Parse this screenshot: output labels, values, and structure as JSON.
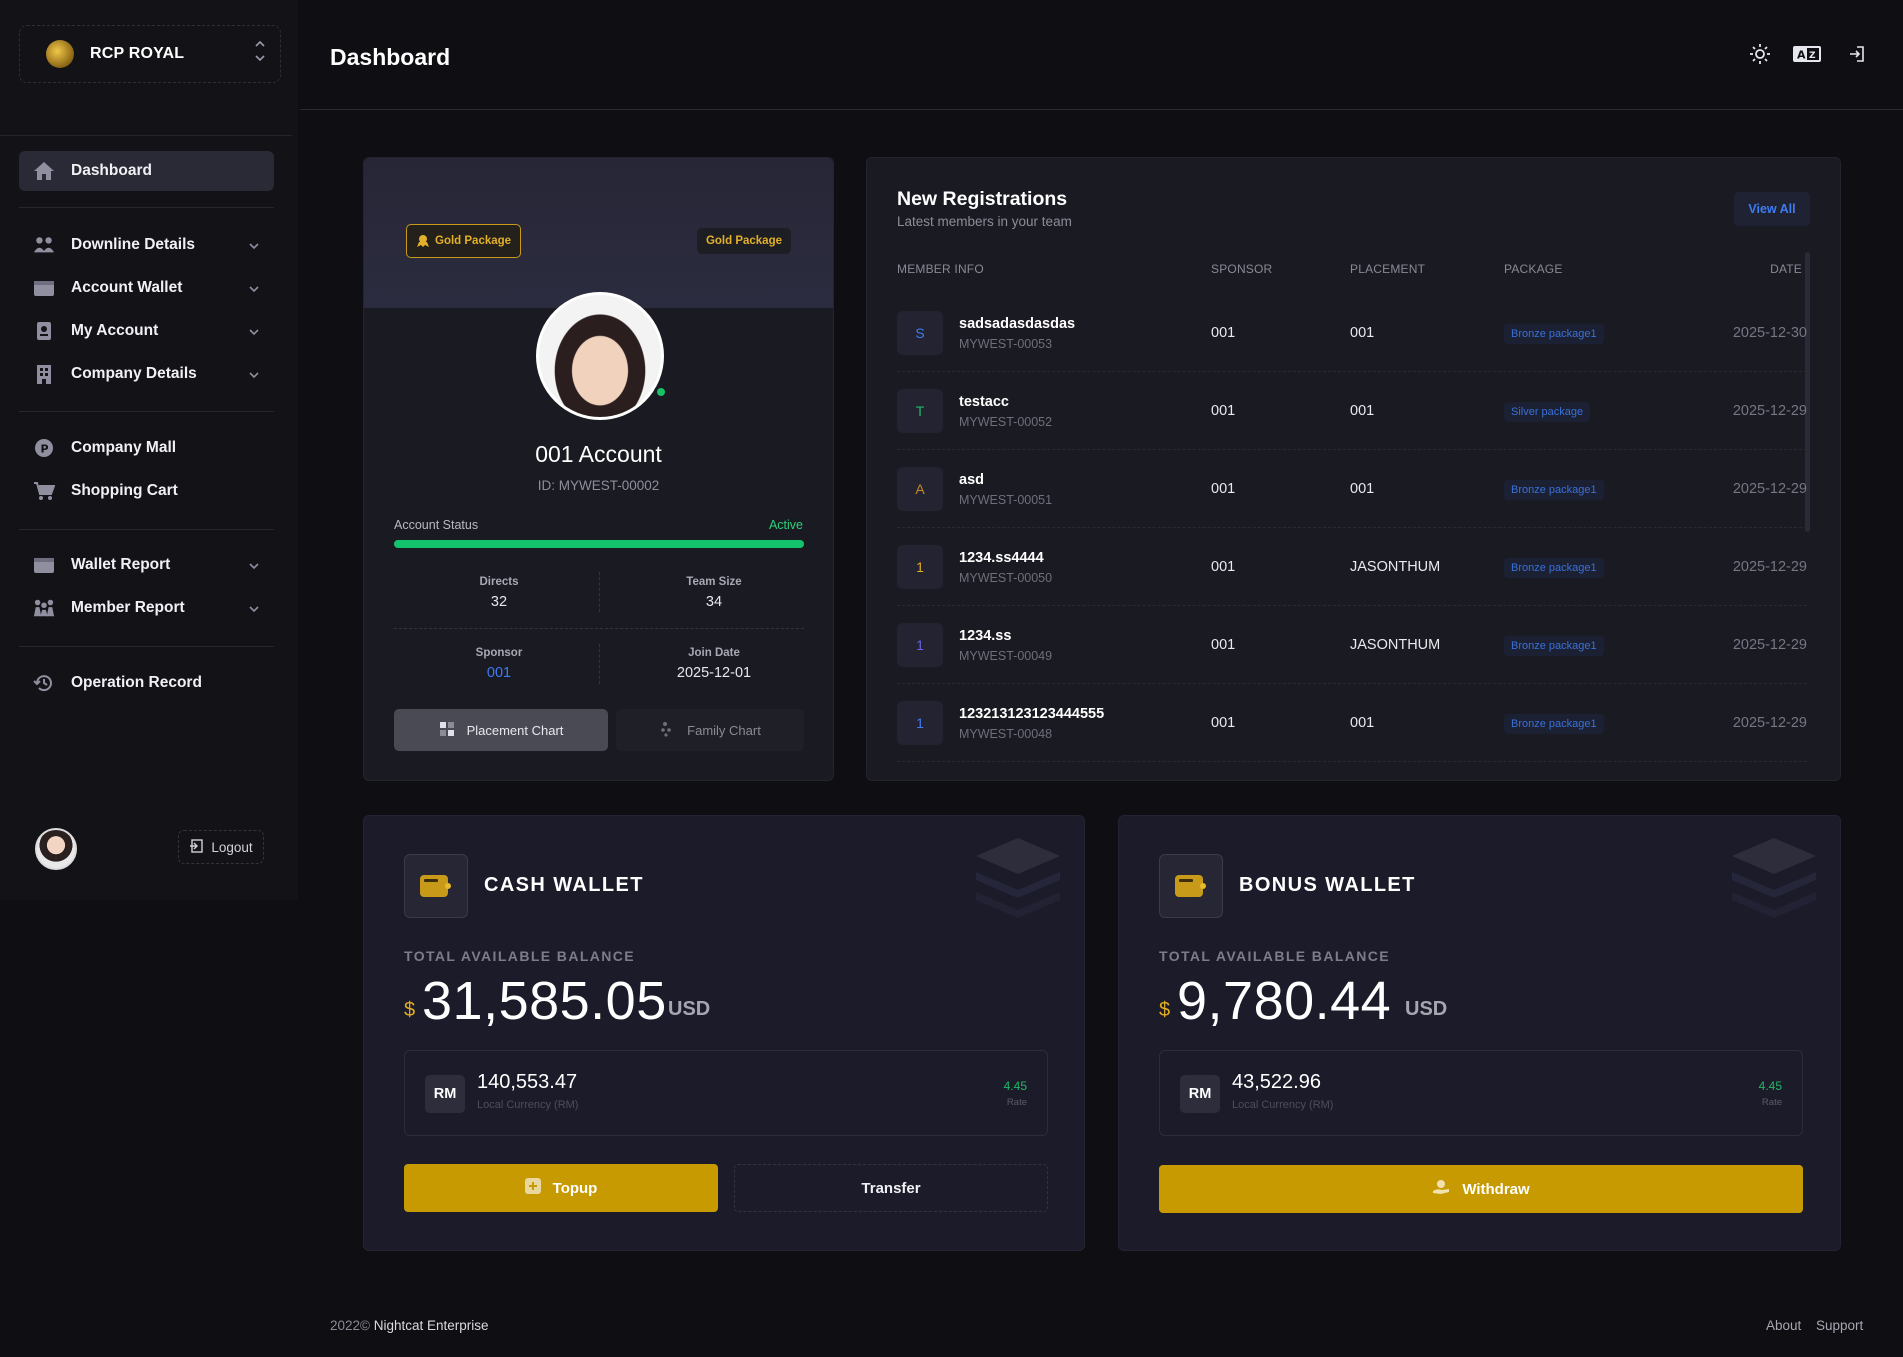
{
  "brand": {
    "name": "RCP ROYAL"
  },
  "sidebar": {
    "items": [
      {
        "label": "Dashboard",
        "icon": "home-icon"
      },
      {
        "label": "Downline Details",
        "icon": "users-icon"
      },
      {
        "label": "Account Wallet",
        "icon": "wallet-icon"
      },
      {
        "label": "My Account",
        "icon": "id-card-icon"
      },
      {
        "label": "Company Details",
        "icon": "building-icon"
      },
      {
        "label": "Company Mall",
        "icon": "mall-icon"
      },
      {
        "label": "Shopping Cart",
        "icon": "cart-icon"
      },
      {
        "label": "Wallet Report",
        "icon": "wallet-icon"
      },
      {
        "label": "Member Report",
        "icon": "group-icon"
      },
      {
        "label": "Operation Record",
        "icon": "history-icon"
      }
    ],
    "logout_label": "Logout"
  },
  "header": {
    "title": "Dashboard"
  },
  "profile": {
    "package_badge": "Gold Package",
    "package_tag": "Gold Package",
    "name": "001 Account",
    "id": "ID: MYWEST-00002",
    "status_label": "Account Status",
    "status_value": "Active",
    "status_progress": 1.0,
    "stats": {
      "directs_label": "Directs",
      "directs": "32",
      "team_label": "Team Size",
      "team": "34",
      "sponsor_label": "Sponsor",
      "sponsor": "001",
      "join_label": "Join Date",
      "join": "2025-12-01"
    },
    "placement_chart": "Placement Chart",
    "family_chart": "Family Chart"
  },
  "registrations": {
    "title": "New Registrations",
    "subtitle": "Latest members in your team",
    "view_all": "View All",
    "columns": [
      "MEMBER INFO",
      "SPONSOR",
      "PLACEMENT",
      "PACKAGE",
      "DATE"
    ],
    "rows": [
      {
        "initial": "S",
        "name": "sadsadasdasdas",
        "id": "MYWEST-00053",
        "sponsor": "001",
        "placement": "001",
        "package": "Bronze package1",
        "date": "2025-12-30",
        "color": "#3e7cf2"
      },
      {
        "initial": "T",
        "name": "testacc",
        "id": "MYWEST-00052",
        "sponsor": "001",
        "placement": "001",
        "package": "Silver package",
        "date": "2025-12-29",
        "color": "#1fb867"
      },
      {
        "initial": "A",
        "name": "asd",
        "id": "MYWEST-00051",
        "sponsor": "001",
        "placement": "001",
        "package": "Bronze package1",
        "date": "2025-12-29",
        "color": "#c9862a"
      },
      {
        "initial": "1",
        "name": "1234.ss4444",
        "id": "MYWEST-00050",
        "sponsor": "001",
        "placement": "JASONTHUM",
        "package": "Bronze package1",
        "date": "2025-12-29",
        "color": "#e3ad22"
      },
      {
        "initial": "1",
        "name": "1234.ss",
        "id": "MYWEST-00049",
        "sponsor": "001",
        "placement": "JASONTHUM",
        "package": "Bronze package1",
        "date": "2025-12-29",
        "color": "#6b63e6"
      },
      {
        "initial": "1",
        "name": "123213123123444555",
        "id": "MYWEST-00048",
        "sponsor": "001",
        "placement": "001",
        "package": "Bronze package1",
        "date": "2025-12-29",
        "color": "#3e7cf2"
      }
    ]
  },
  "cash_wallet": {
    "title": "CASH WALLET",
    "balance_label": "TOTAL AVAILABLE BALANCE",
    "currency_symbol": "$",
    "amount": "31,585.05",
    "currency": "USD",
    "local_badge": "RM",
    "local_amount": "140,553.47",
    "local_label": "Local Currency (RM)",
    "rate": "4.45",
    "rate_label": "Rate",
    "topup_label": "Topup",
    "transfer_label": "Transfer"
  },
  "bonus_wallet": {
    "title": "BONUS WALLET",
    "balance_label": "TOTAL AVAILABLE BALANCE",
    "currency_symbol": "$",
    "amount": "9,780.44",
    "currency": "USD",
    "local_badge": "RM",
    "local_amount": "43,522.96",
    "local_label": "Local Currency (RM)",
    "rate": "4.45",
    "rate_label": "Rate",
    "withdraw_label": "Withdraw"
  },
  "footer": {
    "year": "2022©",
    "company": "Nightcat Enterprise",
    "about": "About",
    "support": "Support"
  },
  "colors": {
    "accent_gold": "#c79a02",
    "active_green": "#13c46c",
    "link_blue": "#3e7cf2"
  }
}
